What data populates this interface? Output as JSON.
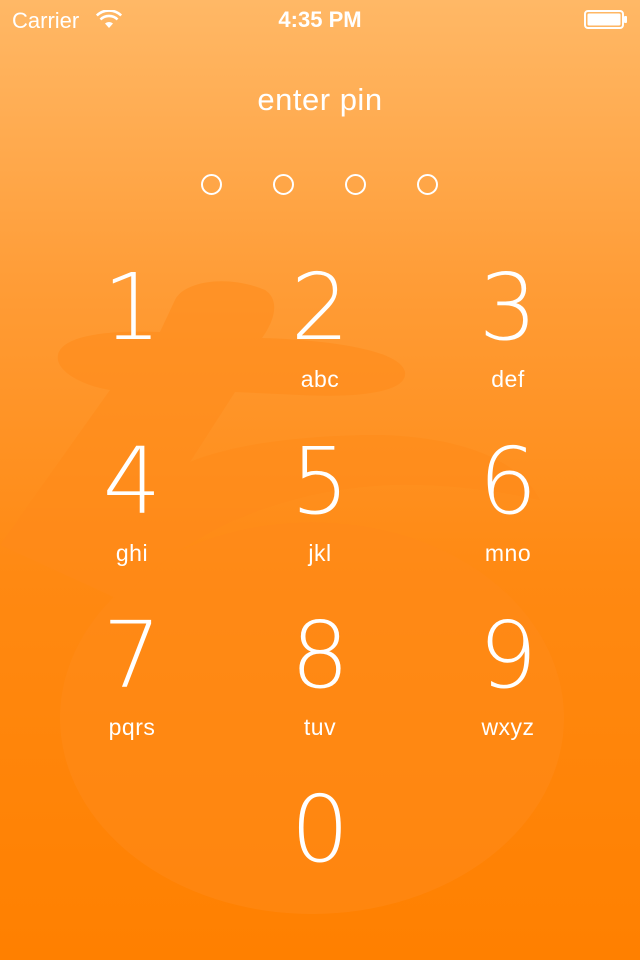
{
  "status_bar": {
    "carrier": "Carrier",
    "time": "4:35 PM",
    "wifi_icon": "wifi-icon",
    "battery_icon": "battery-full-icon"
  },
  "title": "enter pin",
  "pin": {
    "length": 4,
    "entered": 0
  },
  "keys": [
    {
      "digit": "1",
      "letters": ""
    },
    {
      "digit": "2",
      "letters": "abc"
    },
    {
      "digit": "3",
      "letters": "def"
    },
    {
      "digit": "4",
      "letters": "ghi"
    },
    {
      "digit": "5",
      "letters": "jkl"
    },
    {
      "digit": "6",
      "letters": "mno"
    },
    {
      "digit": "7",
      "letters": "pqrs"
    },
    {
      "digit": "8",
      "letters": "tuv"
    },
    {
      "digit": "9",
      "letters": "wxyz"
    },
    {
      "digit": "0",
      "letters": ""
    }
  ],
  "colors": {
    "background_top": "#ffb866",
    "background_bottom": "#ff8000",
    "foreground": "#ffffff"
  }
}
